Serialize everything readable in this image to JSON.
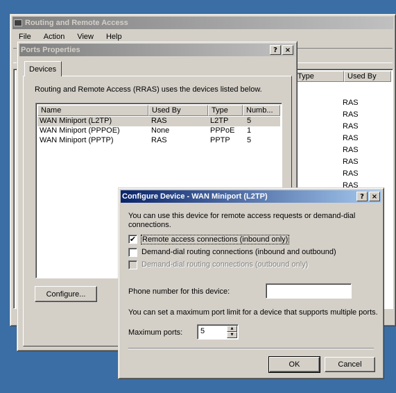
{
  "rras_window": {
    "title": "Routing and Remote Access",
    "menu": [
      {
        "label": "File"
      },
      {
        "label": "Action"
      },
      {
        "label": "View"
      },
      {
        "label": "Help"
      }
    ],
    "columns": [
      {
        "label": "Type"
      },
      {
        "label": "Used By"
      }
    ],
    "used_by_values": [
      "RAS",
      "RAS",
      "RAS",
      "RAS",
      "RAS",
      "RAS",
      "RAS",
      "RAS"
    ]
  },
  "ports_dialog": {
    "title": "Ports Properties",
    "help_glyph": "?",
    "close_glyph": "×",
    "tab_label": "Devices",
    "description": "Routing and Remote Access (RRAS) uses the devices listed below.",
    "columns": [
      {
        "label": "Name"
      },
      {
        "label": "Used By"
      },
      {
        "label": "Type"
      },
      {
        "label": "Numb..."
      }
    ],
    "rows": [
      {
        "name": "WAN Miniport (L2TP)",
        "used_by": "RAS",
        "type": "L2TP",
        "number": "5"
      },
      {
        "name": "WAN Miniport (PPPOE)",
        "used_by": "None",
        "type": "PPPoE",
        "number": "1"
      },
      {
        "name": "WAN Miniport (PPTP)",
        "used_by": "RAS",
        "type": "PPTP",
        "number": "5"
      }
    ],
    "configure_button": "Configure..."
  },
  "configure_dialog": {
    "title": "Configure Device - WAN Miniport (L2TP)",
    "help_glyph": "?",
    "close_glyph": "×",
    "intro": "You can use this device for remote access requests or demand-dial connections.",
    "options": [
      {
        "label": "Remote access connections (inbound only)",
        "checked": true,
        "enabled": true
      },
      {
        "label": "Demand-dial routing connections (inbound and outbound)",
        "checked": false,
        "enabled": true
      },
      {
        "label": "Demand-dial routing connections (outbound only)",
        "checked": false,
        "enabled": false
      }
    ],
    "check_glyph": "✔",
    "phone_label": "Phone number for this device:",
    "phone_value": "",
    "port_limit_text": "You can set a maximum port limit for a device that supports multiple ports.",
    "max_ports_label": "Maximum ports:",
    "max_ports_value": "5",
    "spin_up_glyph": "▲",
    "spin_down_glyph": "▼",
    "ok_button": "OK",
    "cancel_button": "Cancel"
  },
  "colors": {
    "desktop": "#3a6ea5",
    "active_title": "#0a246a",
    "inactive_title": "#808080",
    "face": "#d4d0c8"
  }
}
